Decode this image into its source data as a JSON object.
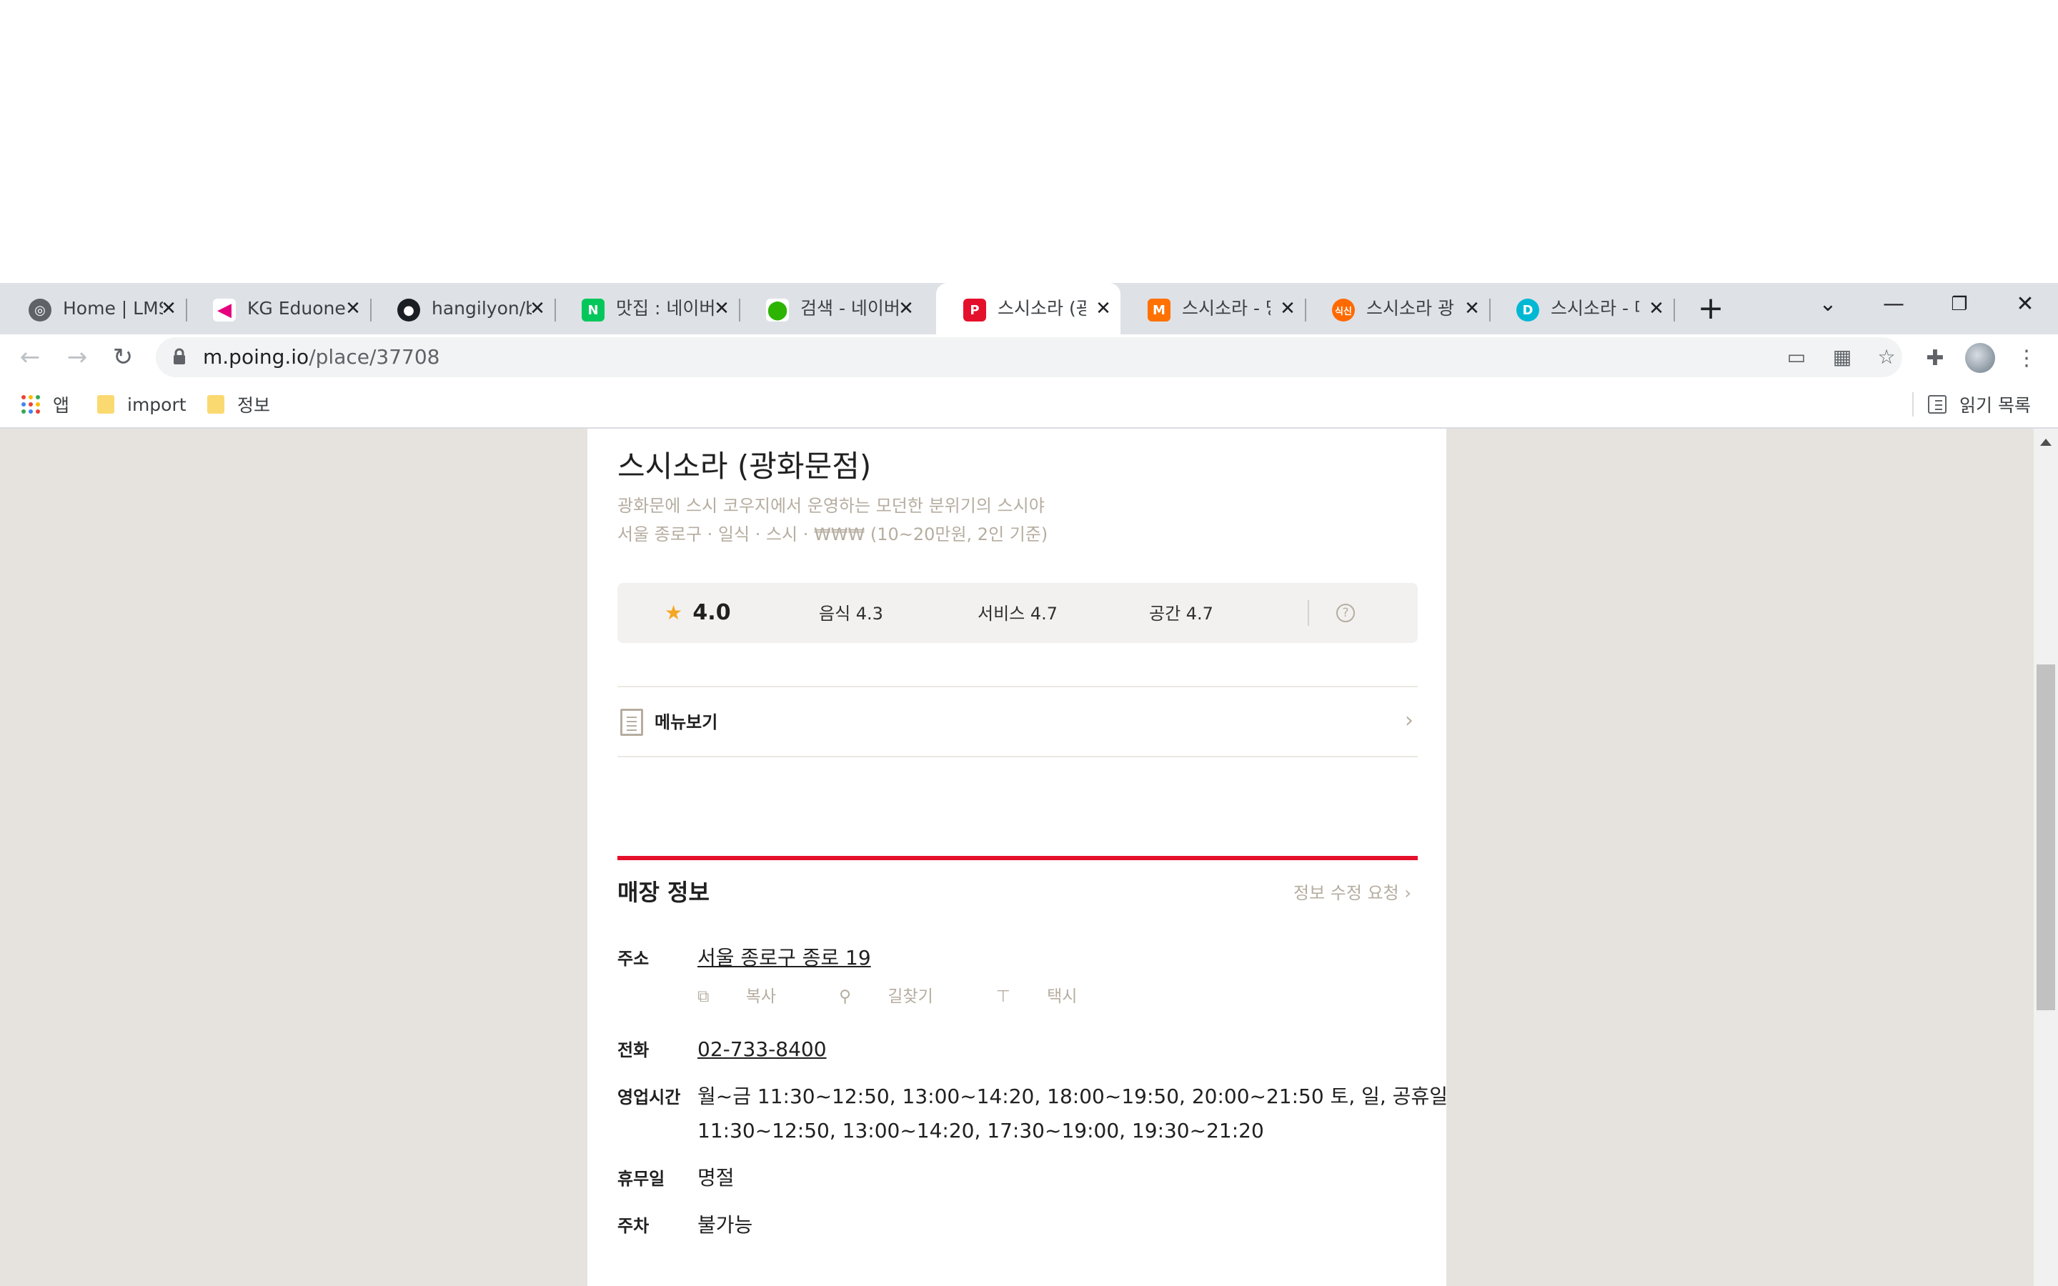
{
  "browser": {
    "tabs": [
      {
        "title": "Home | LMS",
        "favicon": "globe-icon",
        "color": "#5f6368"
      },
      {
        "title": "KG Eduone",
        "favicon": "kg-logo-icon",
        "color": "#e6007e"
      },
      {
        "title": "hangilyon/b",
        "favicon": "github-icon",
        "color": "#1b1f23"
      },
      {
        "title": "맛집 : 네이버",
        "favicon": "naver-icon",
        "color": "#03c75a"
      },
      {
        "title": "검색 - 네이버",
        "favicon": "naver-map-icon",
        "color": "#2db400"
      },
      {
        "title": "스시소라 (광화문",
        "favicon": "poing-icon",
        "color": "#e4102b"
      },
      {
        "title": "스시소라 - 망고",
        "favicon": "mangoplate-icon",
        "color": "#ff7100"
      },
      {
        "title": "스시소라 광화문",
        "favicon": "siksin-icon",
        "color": "#ff6a00"
      },
      {
        "title": "스시소라 - 다이닝",
        "favicon": "diningcode-icon",
        "color": "#00b8d4"
      }
    ],
    "active_tab": 5,
    "url_host": "m.poing.io",
    "url_path": "/place/37708",
    "bookmarks": [
      {
        "label": "앱"
      },
      {
        "label": "import"
      },
      {
        "label": "정보"
      }
    ],
    "reading_list": "읽기 목록"
  },
  "place": {
    "name": "스시소라 (광화문점)",
    "description": "광화문에 스시 코우지에서 운영하는 모던한 분위기의 스시야",
    "meta": "서울 종로구 · 일식 · 스시 · ₩₩₩ (10~20만원, 2인 기준)",
    "rating_overall": "4.0",
    "rating_food": "음식 4.3",
    "rating_service": "서비스 4.7",
    "rating_space": "공간 4.7",
    "help_glyph": "?",
    "menu_label": "메뉴보기"
  },
  "store_info": {
    "title": "매장 정보",
    "edit_link": "정보 수정 요청",
    "address_label": "주소",
    "address": "서울 종로구 종로 19",
    "copy": "복사",
    "directions": "길찾기",
    "taxi": "택시",
    "phone_label": "전화",
    "phone": "02-733-8400",
    "hours_label": "영업시간",
    "hours_line1": "월~금 11:30~12:50, 13:00~14:20, 18:00~19:50, 20:00~21:50 토, 일, 공휴일",
    "hours_line2": "11:30~12:50, 13:00~14:20, 17:30~19:00, 19:30~21:20",
    "closed_label": "휴무일",
    "closed": "명절",
    "parking_label": "주차",
    "parking": "불가능"
  }
}
